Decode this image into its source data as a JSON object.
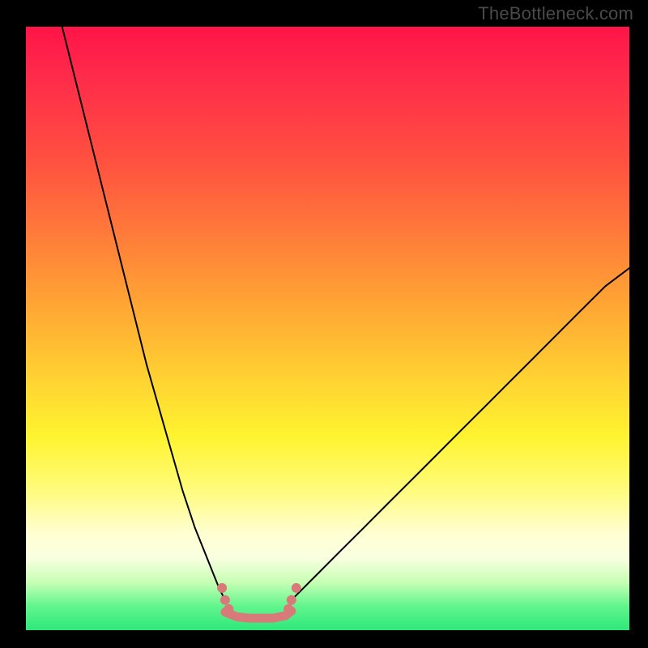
{
  "watermark": "TheBottleneck.com",
  "chart_data": {
    "type": "line",
    "title": "",
    "xlabel": "",
    "ylabel": "",
    "xlim": [
      0,
      100
    ],
    "ylim": [
      0,
      100
    ],
    "gradient_stops": [
      {
        "pos": 0,
        "color": "#ff1448"
      },
      {
        "pos": 8,
        "color": "#ff2a4a"
      },
      {
        "pos": 22,
        "color": "#ff5040"
      },
      {
        "pos": 34,
        "color": "#ff7a3a"
      },
      {
        "pos": 46,
        "color": "#ffa534"
      },
      {
        "pos": 58,
        "color": "#ffd132"
      },
      {
        "pos": 68,
        "color": "#fff430"
      },
      {
        "pos": 76,
        "color": "#fffb74"
      },
      {
        "pos": 84,
        "color": "#ffffd2"
      },
      {
        "pos": 88,
        "color": "#f9ffe0"
      },
      {
        "pos": 92,
        "color": "#c8ffb4"
      },
      {
        "pos": 96,
        "color": "#62f58e"
      },
      {
        "pos": 100,
        "color": "#2ee87a"
      }
    ],
    "series": [
      {
        "name": "left_branch",
        "color": "#000000",
        "width": 2,
        "x": [
          6,
          8,
          10,
          12,
          14,
          16,
          18,
          20,
          22,
          24,
          26,
          28,
          30,
          32,
          33
        ],
        "y": [
          100,
          92,
          84,
          76,
          68,
          60,
          52,
          44,
          37,
          30,
          23,
          17,
          12,
          7,
          5
        ]
      },
      {
        "name": "right_branch",
        "color": "#000000",
        "width": 2,
        "x": [
          44,
          46,
          48,
          52,
          56,
          60,
          64,
          68,
          72,
          76,
          80,
          84,
          88,
          92,
          96,
          100
        ],
        "y": [
          5,
          7,
          9,
          13,
          17,
          21,
          25,
          29,
          33,
          37,
          41,
          45,
          49,
          53,
          57,
          60
        ]
      },
      {
        "name": "flat_bottom",
        "color": "#d97a7a",
        "width": 11,
        "x": [
          33,
          35,
          37,
          39,
          41,
          43,
          44
        ],
        "y": [
          3,
          2.2,
          2,
          2,
          2,
          2.4,
          3.2
        ]
      },
      {
        "name": "marker_dots",
        "color": "#d97a7a",
        "radius": 6,
        "points": [
          {
            "x": 32.5,
            "y": 7.0
          },
          {
            "x": 33.0,
            "y": 5.0
          },
          {
            "x": 33.6,
            "y": 3.5
          },
          {
            "x": 43.5,
            "y": 3.5
          },
          {
            "x": 44.0,
            "y": 5.0
          },
          {
            "x": 44.8,
            "y": 7.0
          }
        ]
      }
    ]
  }
}
